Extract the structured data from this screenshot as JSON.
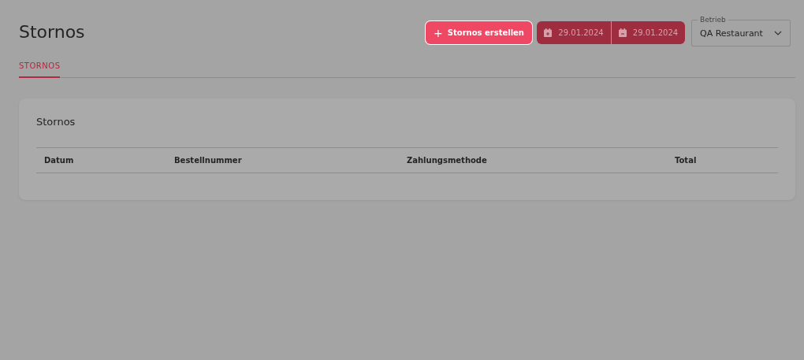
{
  "page_title": "Stornos",
  "create_button": {
    "label": "Stornos erstellen",
    "icon": "+"
  },
  "date_range": {
    "start": "29.01.2024",
    "end": "29.01.2024"
  },
  "business_select": {
    "label": "Betrieb",
    "value": "QA Restaurant"
  },
  "tabs": [
    {
      "label": "STORNOS",
      "selected": true
    }
  ],
  "card": {
    "title": "Stornos",
    "columns": [
      "Datum",
      "Bestellnummer",
      "Zahlungsmethode",
      "Total"
    ]
  }
}
